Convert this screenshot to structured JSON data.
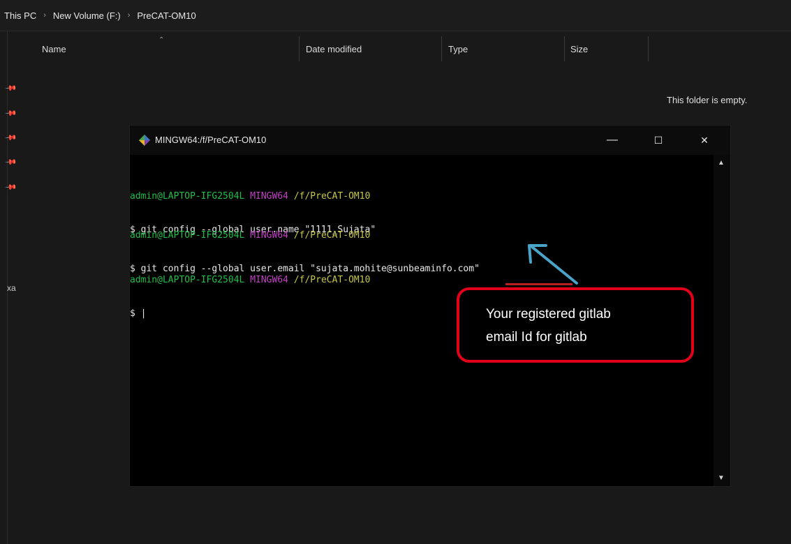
{
  "explorer": {
    "breadcrumb": [
      "This PC",
      "New Volume (F:)",
      "PreCAT-OM10"
    ],
    "columns": [
      "Name",
      "Date modified",
      "Type",
      "Size"
    ],
    "empty_message": "This folder is empty.",
    "truncated_sidebar_text": "xa"
  },
  "terminal": {
    "title": "MINGW64:/f/PreCAT-OM10",
    "controls": {
      "minimize": "—",
      "maximize": "☐",
      "close": "✕"
    },
    "prompt": {
      "user": "admin@LAPTOP-IFG2504L",
      "system": "MINGW64",
      "path": "/f/PreCAT-OM10"
    },
    "commands": [
      "$ git config --global user.name \"1111_Sujata\"",
      "$ git config --global user.email \"sujata.mohite@sunbeaminfo.com\"",
      "$ |"
    ]
  },
  "annotation": {
    "line1": "Your registered gitlab",
    "line2": "email Id for gitlab",
    "colors": {
      "border": "#e3001b",
      "arrow": "#4aa3c8"
    }
  }
}
